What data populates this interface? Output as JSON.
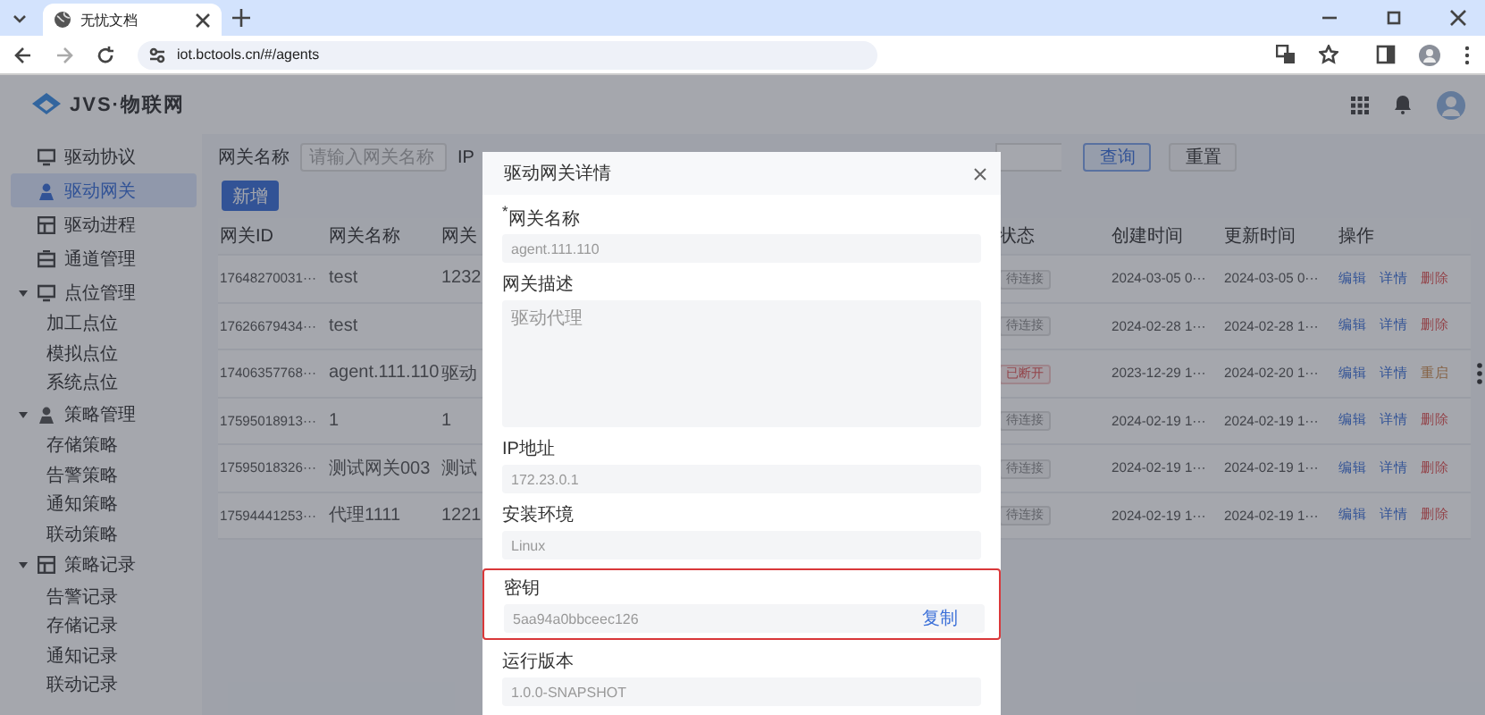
{
  "browser": {
    "tabs": [
      {
        "title": "无忧文档",
        "selected": true
      }
    ],
    "address": "iot.bctools.cn/#/agents"
  },
  "app": {
    "logo": "JVS·物联网"
  },
  "sidebar": {
    "items": [
      {
        "label": "驱动协议",
        "selected": false
      },
      {
        "label": "驱动网关",
        "selected": true
      },
      {
        "label": "驱动进程",
        "selected": false
      },
      {
        "label": "通道管理",
        "selected": false
      },
      {
        "label": "点位管理",
        "selected": false,
        "expanded": true,
        "children": [
          {
            "label": "加工点位",
            "selected": false
          },
          {
            "label": "模拟点位",
            "selected": false
          },
          {
            "label": "系统点位",
            "selected": false
          }
        ]
      },
      {
        "label": "策略管理",
        "selected": false,
        "expanded": true,
        "children": [
          {
            "label": "存储策略",
            "selected": false
          },
          {
            "label": "告警策略",
            "selected": false
          },
          {
            "label": "通知策略",
            "selected": false
          },
          {
            "label": "联动策略",
            "selected": false
          }
        ]
      },
      {
        "label": "策略记录",
        "selected": false,
        "expanded": true,
        "children": [
          {
            "label": "告警记录",
            "selected": false
          },
          {
            "label": "存储记录",
            "selected": false
          },
          {
            "label": "通知记录",
            "selected": false
          },
          {
            "label": "联动记录",
            "selected": false
          }
        ]
      }
    ]
  },
  "filters": {
    "name_label": "网关名称",
    "name_placeholder": "请输入网关名称",
    "ip_label": "IP",
    "buttons": [
      {
        "label": "查询",
        "kind": "primary"
      },
      {
        "label": "重置",
        "kind": "plain"
      }
    ]
  },
  "add_button": "新增",
  "table": {
    "columns": [
      "网关ID",
      "网关名称",
      "网关",
      "状态",
      "创建时间",
      "更新时间",
      "操作"
    ],
    "rows": [
      {
        "id": "17648270031···",
        "name": "test",
        "description": "1232",
        "status": {
          "label": "待连接",
          "kind": "pending"
        },
        "created": "2024-03-05 0···",
        "updated": "2024-03-05 0···",
        "actions": [
          {
            "label": "编辑",
            "kind": "edit"
          },
          {
            "label": "详情",
            "kind": "detail"
          },
          {
            "label": "删除",
            "kind": "delete"
          }
        ],
        "more": false
      },
      {
        "id": "17626679434···",
        "name": "test",
        "description": "",
        "status": {
          "label": "待连接",
          "kind": "pending"
        },
        "created": "2024-02-28 1···",
        "updated": "2024-02-28 1···",
        "actions": [
          {
            "label": "编辑",
            "kind": "edit"
          },
          {
            "label": "详情",
            "kind": "detail"
          },
          {
            "label": "删除",
            "kind": "delete"
          }
        ],
        "more": false
      },
      {
        "id": "17406357768···",
        "name": "agent.111.110",
        "description": "驱动",
        "status": {
          "label": "已断开",
          "kind": "disconnected"
        },
        "created": "2023-12-29 1···",
        "updated": "2024-02-20 1···",
        "actions": [
          {
            "label": "编辑",
            "kind": "edit"
          },
          {
            "label": "详情",
            "kind": "detail"
          },
          {
            "label": "重启",
            "kind": "restart"
          }
        ],
        "more": true
      },
      {
        "id": "17595018913···",
        "name": "1",
        "description": "1",
        "status": {
          "label": "待连接",
          "kind": "pending"
        },
        "created": "2024-02-19 1···",
        "updated": "2024-02-19 1···",
        "actions": [
          {
            "label": "编辑",
            "kind": "edit"
          },
          {
            "label": "详情",
            "kind": "detail"
          },
          {
            "label": "删除",
            "kind": "delete"
          }
        ],
        "more": false
      },
      {
        "id": "17595018326···",
        "name": "测试网关003",
        "description": "测试",
        "status": {
          "label": "待连接",
          "kind": "pending"
        },
        "created": "2024-02-19 1···",
        "updated": "2024-02-19 1···",
        "actions": [
          {
            "label": "编辑",
            "kind": "edit"
          },
          {
            "label": "详情",
            "kind": "detail"
          },
          {
            "label": "删除",
            "kind": "delete"
          }
        ],
        "more": false
      },
      {
        "id": "17594441253···",
        "name": "代理1111",
        "description": "1221",
        "status": {
          "label": "待连接",
          "kind": "pending"
        },
        "created": "2024-02-19 1···",
        "updated": "2024-02-19 1···",
        "actions": [
          {
            "label": "编辑",
            "kind": "edit"
          },
          {
            "label": "详情",
            "kind": "detail"
          },
          {
            "label": "删除",
            "kind": "delete"
          }
        ],
        "more": false
      }
    ]
  },
  "modal": {
    "title": "驱动网关详情",
    "fields": [
      {
        "label": "$^{*}$网关名称",
        "value": "agent.111.110",
        "kind": "input",
        "highlighted": false
      },
      {
        "label": "网关描述",
        "value": "驱动代理",
        "kind": "textarea",
        "highlighted": false
      },
      {
        "label": "IP地址",
        "value": "172.23.0.1",
        "kind": "input",
        "highlighted": false
      },
      {
        "label": "安装环境",
        "value": "Linux",
        "kind": "input",
        "highlighted": false
      },
      {
        "label": "密钥",
        "value": "5aa94a0bbceec126",
        "kind": "input",
        "action": "复制",
        "highlighted": true
      },
      {
        "label": "运行版本",
        "value": "1.0.0-SNAPSHOT",
        "kind": "input",
        "highlighted": false
      }
    ]
  }
}
